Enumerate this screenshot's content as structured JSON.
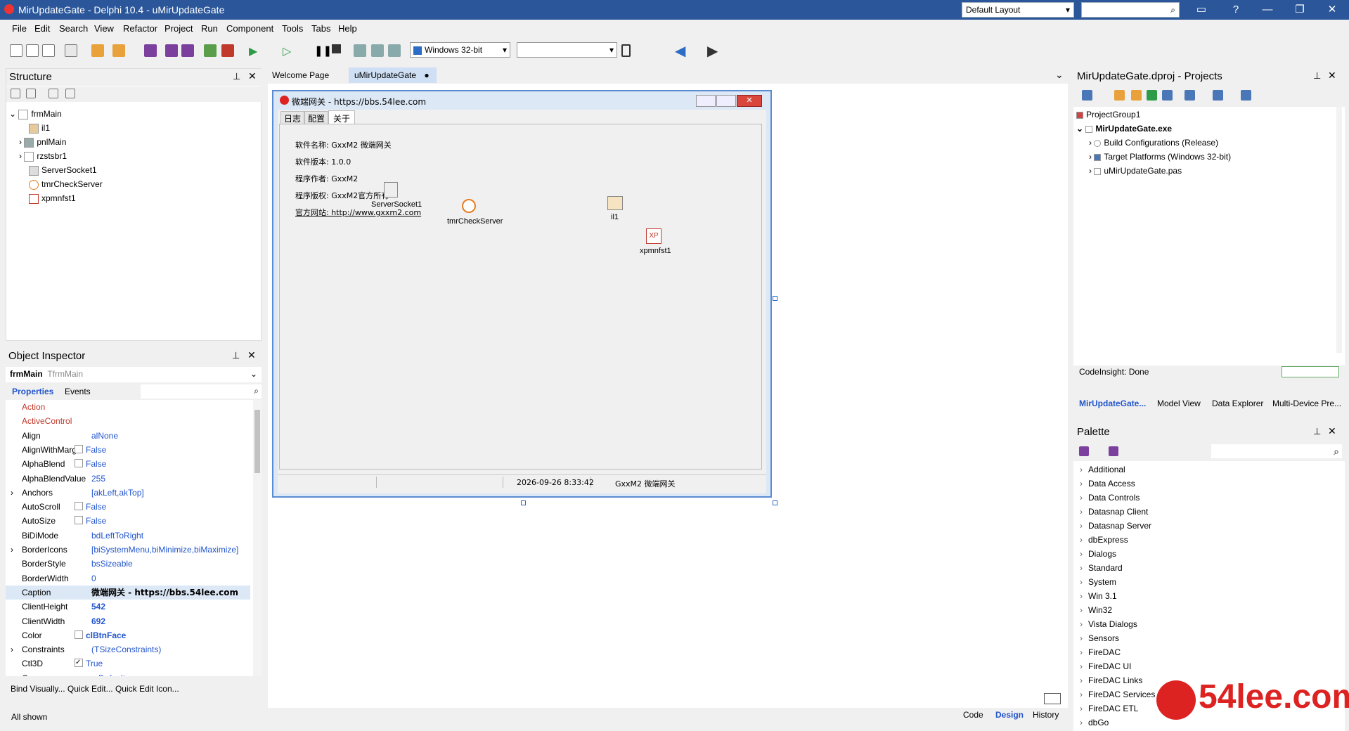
{
  "title": "MirUpdateGate - Delphi 10.4 - uMirUpdateGate",
  "layout_combo": "Default Layout",
  "menu": [
    "File",
    "Edit",
    "Search",
    "View",
    "Refactor",
    "Project",
    "Run",
    "Component",
    "Tools",
    "Tabs",
    "Help"
  ],
  "platform": "Windows 32-bit",
  "structure": {
    "title": "Structure",
    "root": "frmMain",
    "items": [
      "il1",
      "pnlMain",
      "rzstsbr1",
      "ServerSocket1",
      "tmrCheckServer",
      "xpmnfst1"
    ]
  },
  "inspector": {
    "title": "Object Inspector",
    "object": "frmMain",
    "type": "TfrmMain",
    "tabs": [
      "Properties",
      "Events"
    ],
    "rows": [
      {
        "n": "Action",
        "v": ""
      },
      {
        "n": "ActiveControl",
        "v": ""
      },
      {
        "n": "Align",
        "v": "alNone"
      },
      {
        "n": "AlignWithMargi",
        "v": "False"
      },
      {
        "n": "AlphaBlend",
        "v": "False"
      },
      {
        "n": "AlphaBlendValue",
        "v": "255"
      },
      {
        "n": "Anchors",
        "v": "[akLeft,akTop]"
      },
      {
        "n": "AutoScroll",
        "v": "False"
      },
      {
        "n": "AutoSize",
        "v": "False"
      },
      {
        "n": "BiDiMode",
        "v": "bdLeftToRight"
      },
      {
        "n": "BorderIcons",
        "v": "[biSystemMenu,biMinimize,biMaximize]"
      },
      {
        "n": "BorderStyle",
        "v": "bsSizeable"
      },
      {
        "n": "BorderWidth",
        "v": "0"
      },
      {
        "n": "Caption",
        "v": "微端网关 - https://bbs.54lee.com"
      },
      {
        "n": "ClientHeight",
        "v": "542"
      },
      {
        "n": "ClientWidth",
        "v": "692"
      },
      {
        "n": "Color",
        "v": "clBtnFace"
      },
      {
        "n": "Constraints",
        "v": "(TSizeConstraints)"
      },
      {
        "n": "Ctl3D",
        "v": "True"
      },
      {
        "n": "Cursor",
        "v": "crDefault"
      }
    ],
    "links": "Bind Visually...  Quick Edit...  Quick Edit Icon...",
    "status": "All shown"
  },
  "tabs": [
    "Welcome Page",
    "uMirUpdateGate"
  ],
  "form": {
    "caption": "微端网关 - https://bbs.54lee.com",
    "tabs": [
      "日志",
      "配置",
      "关于"
    ],
    "about": [
      "软件名称: GxxM2 微端网关",
      "软件版本: 1.0.0",
      "程序作者: GxxM2",
      "程序版权: GxxM2官方所有",
      "官方网站: http://www.gxxm2.com"
    ],
    "components": [
      "ServerSocket1",
      "tmrCheckServer",
      "il1",
      "xpmnfst1"
    ],
    "status_time": "2026-09-26 8:33:42",
    "status_name": "GxxM2 微端网关"
  },
  "bottom_tabs": [
    "Code",
    "Design",
    "History"
  ],
  "projects": {
    "title": "MirUpdateGate.dproj - Projects",
    "items": [
      "ProjectGroup1",
      "MirUpdateGate.exe",
      "Build Configurations (Release)",
      "Target Platforms (Windows 32-bit)",
      "uMirUpdateGate.pas"
    ],
    "status": "CodeInsight: Done",
    "tabs": [
      "MirUpdateGate...",
      "Model View",
      "Data Explorer",
      "Multi-Device Pre..."
    ]
  },
  "palette": {
    "title": "Palette",
    "items": [
      "Additional",
      "Data Access",
      "Data Controls",
      "Datasnap Client",
      "Datasnap Server",
      "dbExpress",
      "Dialogs",
      "Standard",
      "System",
      "Win 3.1",
      "Win32",
      "Vista Dialogs",
      "Sensors",
      "FireDAC",
      "FireDAC UI",
      "FireDAC Links",
      "FireDAC Services",
      "FireDAC ETL",
      "dbGo"
    ]
  },
  "watermark": "54lee.com"
}
